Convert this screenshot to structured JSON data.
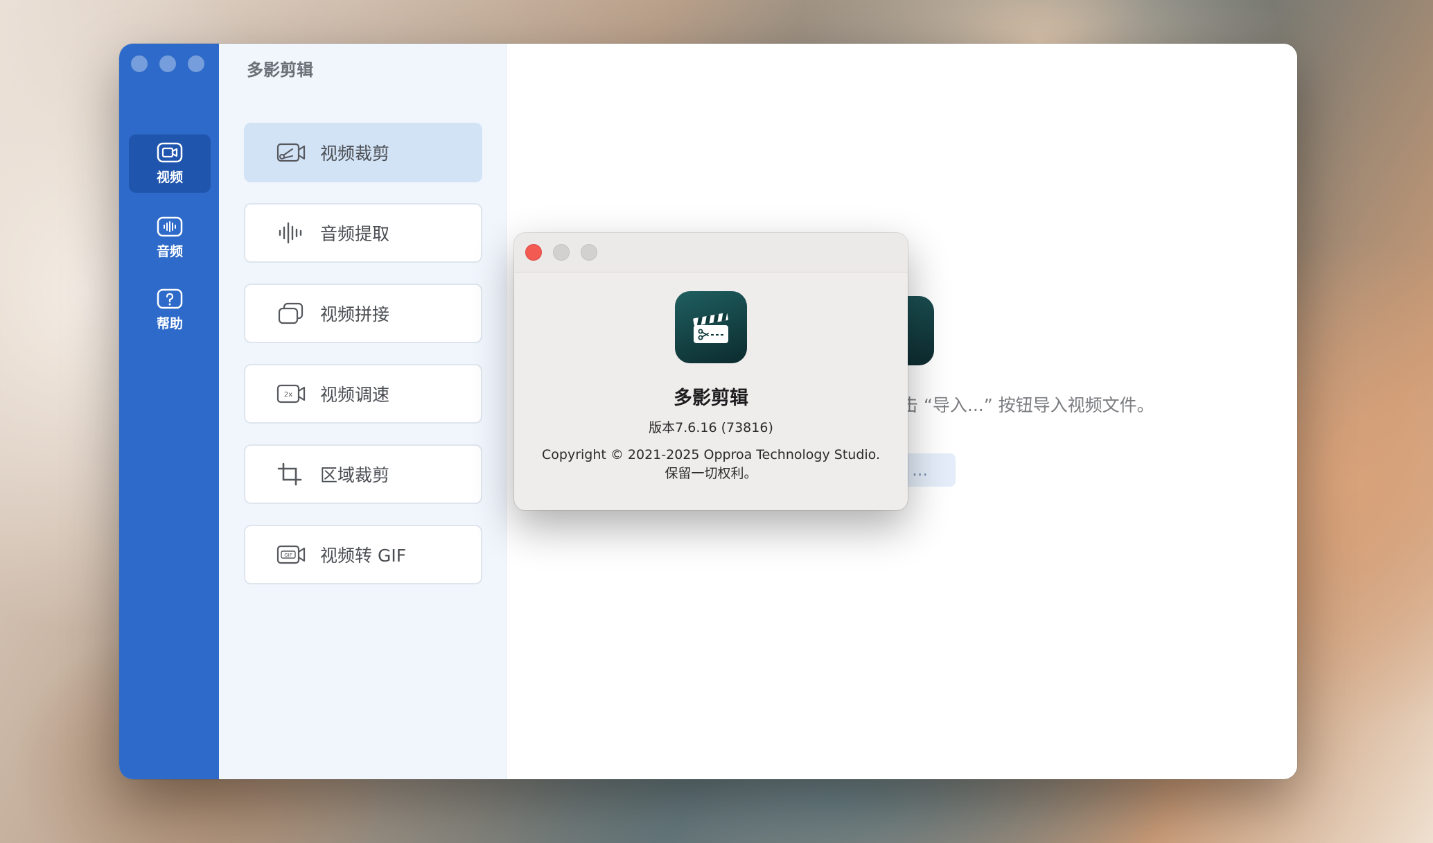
{
  "app": {
    "title": "多影剪辑"
  },
  "rail": {
    "items": [
      {
        "label": "视频",
        "icon": "video-camera-icon",
        "active": true
      },
      {
        "label": "音频",
        "icon": "audio-wave-icon",
        "active": false
      },
      {
        "label": "帮助",
        "icon": "question-icon",
        "active": false
      }
    ]
  },
  "menu": {
    "items": [
      {
        "label": "视频裁剪",
        "icon": "video-cut-icon",
        "active": true
      },
      {
        "label": "音频提取",
        "icon": "audio-wave-icon",
        "active": false
      },
      {
        "label": "视频拼接",
        "icon": "video-join-icon",
        "active": false
      },
      {
        "label": "视频调速",
        "icon": "video-speed-icon",
        "active": false
      },
      {
        "label": "区域裁剪",
        "icon": "crop-icon",
        "active": false
      },
      {
        "label": "视频转 GIF",
        "icon": "video-gif-icon",
        "active": false
      }
    ]
  },
  "content": {
    "hint": "击 “导入...” 按钮导入视频文件。",
    "import_button": "..."
  },
  "about": {
    "app_name": "多影剪辑",
    "version": "版本7.6.16 (73816)",
    "copyright": "Copyright © 2021-2025 Opproa Technology Studio.",
    "rights": "保留一切权利。"
  },
  "colors": {
    "rail": "#2d6ac9",
    "rail_active": "#1f55ad",
    "menu_bg": "#f1f6fd",
    "menu_active": "#d3e3f6",
    "close_button": "#f25a52",
    "app_icon": "#0f3a3c"
  }
}
